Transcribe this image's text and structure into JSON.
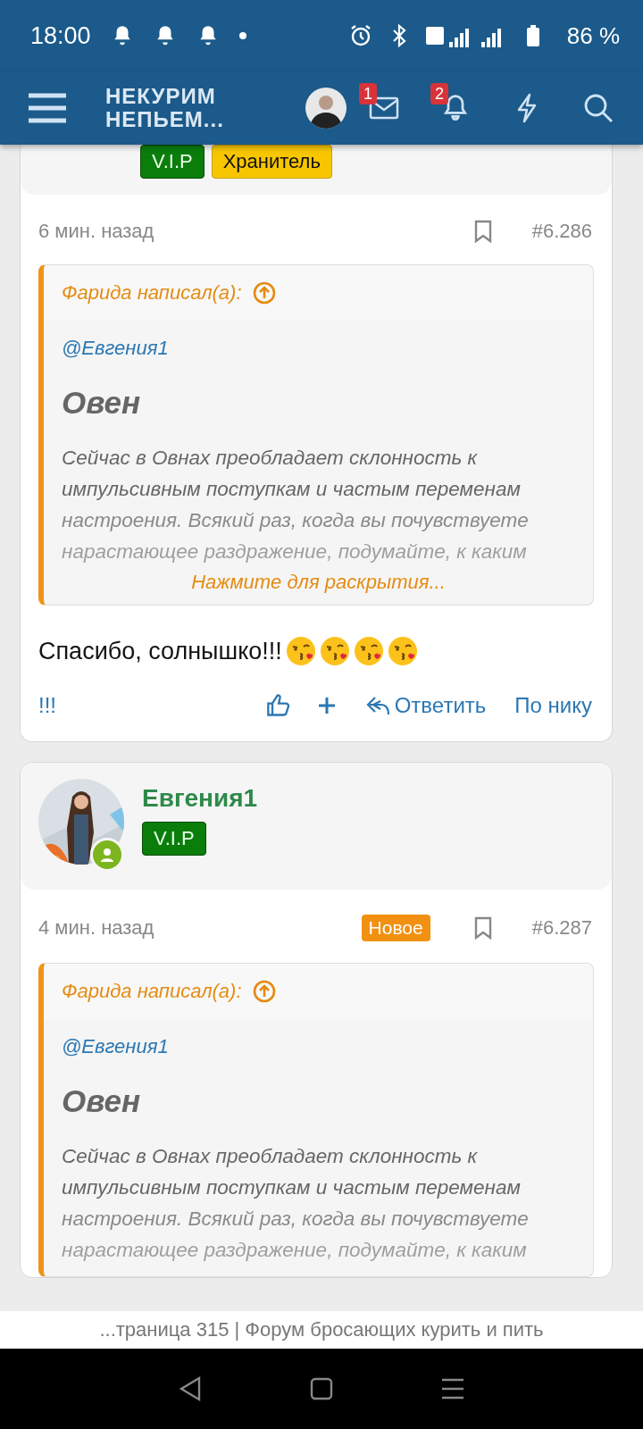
{
  "status_bar": {
    "time": "18:00",
    "battery": "86 %"
  },
  "header": {
    "logo": [
      "НЕКУРИМ",
      "НЕПЬЕМ..."
    ],
    "messages_badge": "1",
    "alerts_badge": "2"
  },
  "posts": [
    {
      "badges": [
        {
          "label": "V.I.P",
          "kind": "vip"
        },
        {
          "label": "Хранитель",
          "kind": "keeper"
        }
      ],
      "time": "6 мин. назад",
      "number": "#6.286",
      "quote": {
        "author": "Фарида написал(а):",
        "mention": "@Евгения1",
        "heading": "Овен",
        "lines": [
          "Сейчас в Овнах преобладает склонность к",
          "импульсивным поступкам и частым переменам",
          "настроения. Всякий раз, когда вы почувствуете",
          "нарастающее раздражение, подумайте, к каким"
        ],
        "expand": "Нажмите для раскрытия..."
      },
      "message": "Спасибо, солнышко!!!",
      "actions": {
        "marker": "!!!",
        "reply": "Ответить",
        "by_nick": "По нику"
      }
    },
    {
      "name": "Евгения1",
      "badges": [
        {
          "label": "V.I.P",
          "kind": "vip"
        }
      ],
      "time": "4 мин. назад",
      "new_label": "Новое",
      "number": "#6.287",
      "quote": {
        "author": "Фарида написал(а):",
        "mention": "@Евгения1",
        "heading": "Овен",
        "lines": [
          "Сейчас в Овнах преобладает склонность к",
          "импульсивным поступкам и частым переменам",
          "настроения. Всякий раз, когда вы почувствуете",
          "нарастающее раздражение, подумайте, к каким"
        ]
      }
    }
  ],
  "page_title": "...траница 315 | Форум бросающих курить и пить"
}
